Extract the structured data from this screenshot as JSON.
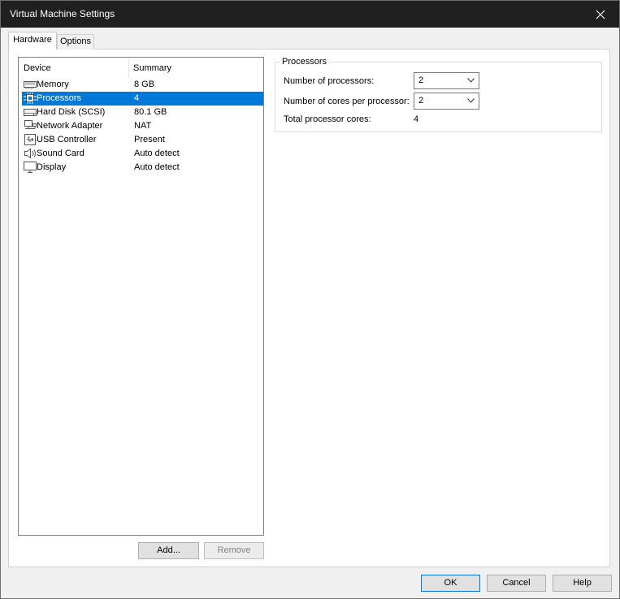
{
  "window": {
    "title": "Virtual Machine Settings"
  },
  "tabs": [
    {
      "label": "Hardware"
    },
    {
      "label": "Options"
    }
  ],
  "device_list": {
    "columns": [
      "Device",
      "Summary"
    ],
    "rows": [
      {
        "name": "Memory",
        "summary": "8 GB",
        "icon": "memory-icon"
      },
      {
        "name": "Processors",
        "summary": "4",
        "icon": "processor-icon",
        "selected": true
      },
      {
        "name": "Hard Disk (SCSI)",
        "summary": "80.1 GB",
        "icon": "hard-disk-icon"
      },
      {
        "name": "Network Adapter",
        "summary": "NAT",
        "icon": "network-adapter-icon"
      },
      {
        "name": "USB Controller",
        "summary": "Present",
        "icon": "usb-icon"
      },
      {
        "name": "Sound Card",
        "summary": "Auto detect",
        "icon": "speaker-icon"
      },
      {
        "name": "Display",
        "summary": "Auto detect",
        "icon": "monitor-icon"
      }
    ],
    "add_label": "Add...",
    "remove_label": "Remove"
  },
  "processors": {
    "group_title": "Processors",
    "num_processors_label": "Number of processors:",
    "num_processors_value": "2",
    "cores_label": "Number of cores per processor:",
    "cores_value": "2",
    "total_label": "Total processor cores:",
    "total_value": "4"
  },
  "footer": {
    "ok_label": "OK",
    "cancel_label": "Cancel",
    "help_label": "Help"
  },
  "colors": {
    "selection": "#0078d7",
    "titlebar": "#202020"
  }
}
